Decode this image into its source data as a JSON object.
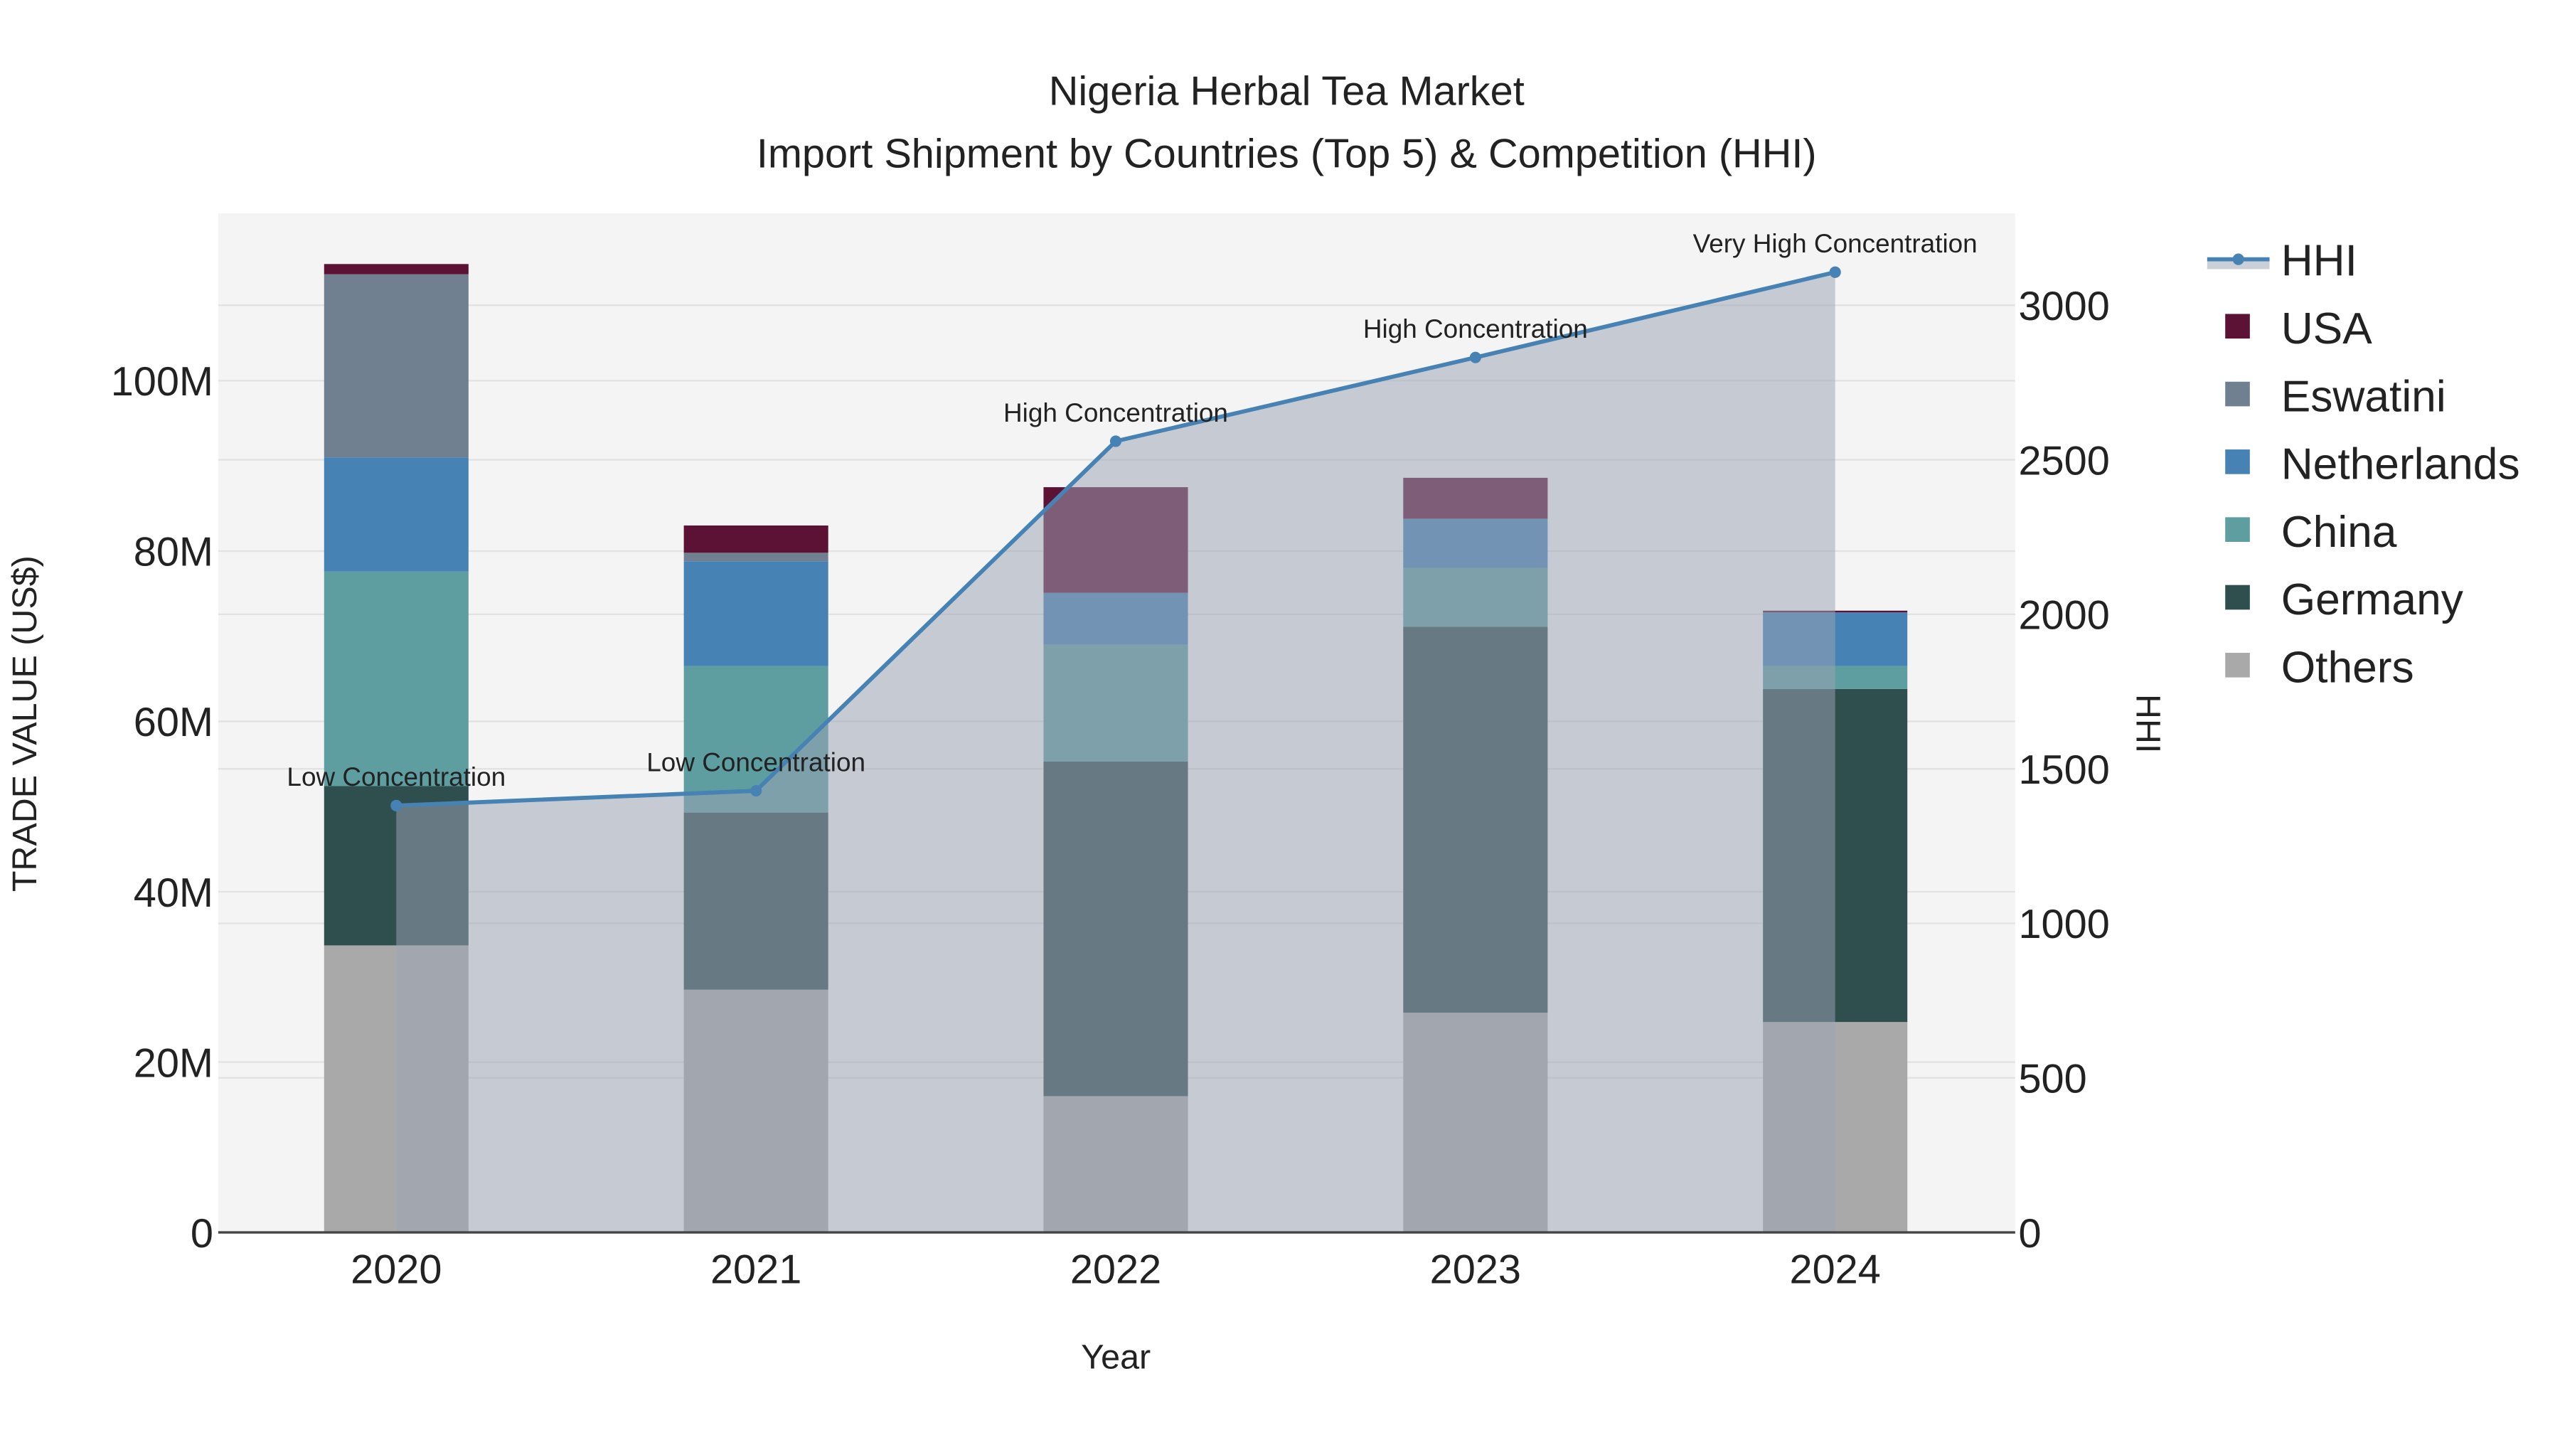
{
  "chart_data": {
    "type": "bar",
    "title": "Nigeria Herbal Tea Market",
    "subtitle": "Import Shipment by Countries (Top 5) & Competition (HHI)",
    "xlabel": "Year",
    "ylabel": "TRADE VALUE (US$)",
    "y2label": "HHI",
    "categories": [
      "2020",
      "2021",
      "2022",
      "2023",
      "2024"
    ],
    "ylim": [
      0,
      118000000
    ],
    "y_ticks": [
      0,
      20000000,
      40000000,
      60000000,
      80000000,
      100000000
    ],
    "y_tick_labels": [
      "0",
      "20M",
      "40M",
      "60M",
      "80M",
      "100M"
    ],
    "y2lim": [
      0,
      3300
    ],
    "y2_ticks": [
      0,
      500,
      1000,
      1500,
      2000,
      2500,
      3000
    ],
    "y2_tick_labels": [
      "0",
      "500",
      "1000",
      "1500",
      "2000",
      "2500",
      "3000"
    ],
    "series": [
      {
        "name": "Others",
        "color": "#a9a9a9",
        "values": [
          33700000,
          28500000,
          16000000,
          25800000,
          24700000
        ]
      },
      {
        "name": "Germany",
        "color": "#2f4f4f",
        "values": [
          18700000,
          20800000,
          39300000,
          45300000,
          39100000
        ]
      },
      {
        "name": "China",
        "color": "#5f9ea0",
        "values": [
          25200000,
          17200000,
          13700000,
          6900000,
          2700000
        ]
      },
      {
        "name": "Netherlands",
        "color": "#4682b4",
        "values": [
          13400000,
          12300000,
          6100000,
          5800000,
          6300000
        ]
      },
      {
        "name": "Eswatini",
        "color": "#708090",
        "values": [
          21500000,
          1000000,
          0,
          0,
          0
        ]
      },
      {
        "name": "USA",
        "color": "#5c1235",
        "values": [
          1200000,
          3200000,
          12400000,
          4800000,
          200000
        ]
      }
    ],
    "line": {
      "name": "HHI",
      "color": "#4682b4",
      "values": [
        1381,
        1429,
        2560,
        2831,
        3107
      ],
      "annotations": [
        "Low Concentration",
        "Low Concentration",
        "High Concentration",
        "High Concentration",
        "Very High Concentration"
      ]
    },
    "legend_order": [
      "HHI",
      "USA",
      "Eswatini",
      "Netherlands",
      "China",
      "Germany",
      "Others"
    ],
    "legend_position": "right",
    "grid": true
  }
}
